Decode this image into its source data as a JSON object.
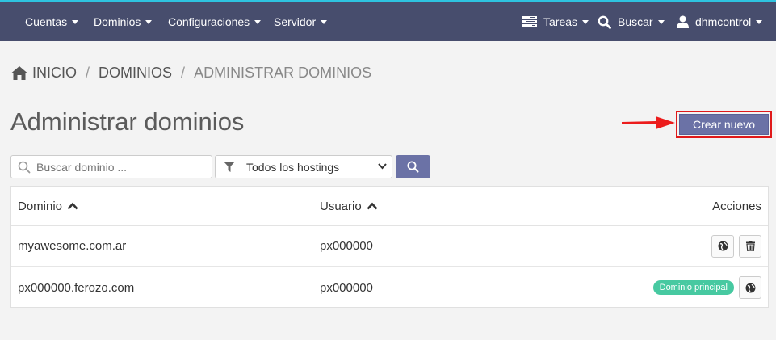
{
  "colors": {
    "navbar": "#474d6d",
    "accent_line": "#2ec3e0",
    "primary_button": "#6b72a6",
    "badge": "#47c9a1",
    "highlight": "#e0191a"
  },
  "navbar": {
    "left_items": [
      {
        "label": "Cuentas"
      },
      {
        "label": "Dominios"
      },
      {
        "label": "Configuraciones"
      },
      {
        "label": "Servidor"
      }
    ],
    "tasks": {
      "label": "Tareas",
      "icon": "tasks-icon"
    },
    "search": {
      "label": "Buscar",
      "icon": "search-icon"
    },
    "user": {
      "label": "dhmcontrol",
      "icon": "user-icon"
    }
  },
  "breadcrumb": {
    "home_icon": "home-icon",
    "items": [
      "INICIO",
      "DOMINIOS",
      "ADMINISTRAR DOMINIOS"
    ]
  },
  "page": {
    "title": "Administrar dominios",
    "create_label": "Crear nuevo"
  },
  "filters": {
    "search_placeholder": "Buscar dominio ...",
    "hosting_select": {
      "selected": "Todos los hostings",
      "icon": "filter-icon"
    },
    "search_button_icon": "search-icon"
  },
  "table": {
    "columns": {
      "domain": "Dominio",
      "user": "Usuario",
      "actions": "Acciones"
    },
    "rows": [
      {
        "domain": "myawesome.com.ar",
        "user": "px000000",
        "actions": [
          "globe-icon",
          "trash-icon"
        ]
      },
      {
        "domain": "px000000.ferozo.com",
        "user": "px000000",
        "badge": "Dominio principal",
        "actions": [
          "globe-icon"
        ]
      }
    ]
  }
}
